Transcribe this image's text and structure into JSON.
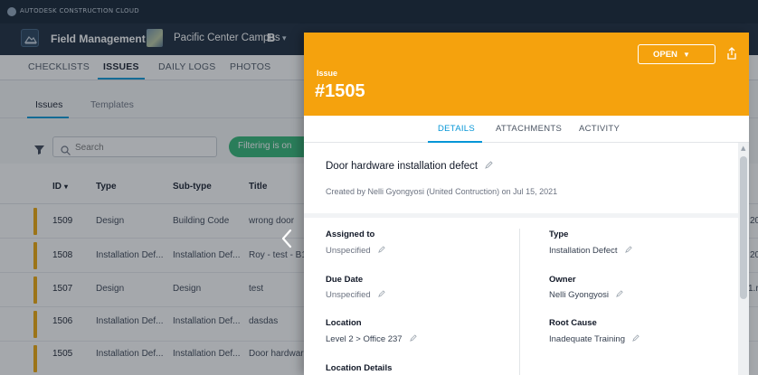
{
  "brand": {
    "text": "AUTODESK CONSTRUCTION CLOUD"
  },
  "project_bar": {
    "tool": "Field Management",
    "project": "Pacific Center Campus",
    "badge": "B"
  },
  "tabs": [
    "CHECKLISTS",
    "ISSUES",
    "DAILY LOGS",
    "PHOTOS"
  ],
  "active_tab": "ISSUES",
  "subtabs": [
    "Issues",
    "Templates"
  ],
  "toolbar": {
    "search_placeholder": "Search",
    "filter_pill": "Filtering is on"
  },
  "table": {
    "columns": [
      "ID",
      "Type",
      "Sub-type",
      "Title"
    ],
    "rows": [
      {
        "id": "1509",
        "type": "Design",
        "subtype": "Building Code",
        "title": "wrong door",
        "right": "20"
      },
      {
        "id": "1508",
        "type": "Installation Def...",
        "subtype": "Installation Def...",
        "title": "Roy - test - B1",
        "right": "20"
      },
      {
        "id": "1507",
        "type": "Design",
        "subtype": "Design",
        "title": "test",
        "right": "1.r"
      },
      {
        "id": "1506",
        "type": "Installation Def...",
        "subtype": "Installation Def...",
        "title": "dasdas",
        "right": ""
      },
      {
        "id": "1505",
        "type": "Installation Def...",
        "subtype": "Installation Def...",
        "title": "Door hardwar",
        "right": ""
      }
    ]
  },
  "panel": {
    "kicker": "Issue",
    "number": "#1505",
    "status": "OPEN",
    "tabs": [
      "DETAILS",
      "ATTACHMENTS",
      "ACTIVITY"
    ],
    "title": "Door hardware installation defect",
    "created": "Created by Nelli Gyongyosi (United Contruction) on Jul 15, 2021",
    "fields": {
      "assigned_label": "Assigned to",
      "assigned_value": "Unspecified",
      "type_label": "Type",
      "type_value": "Installation Defect",
      "due_label": "Due Date",
      "due_value": "Unspecified",
      "owner_label": "Owner",
      "owner_value": "Nelli Gyongyosi",
      "location_label": "Location",
      "location_value": "Level 2 > Office 237",
      "root_label": "Root Cause",
      "root_value": "Inadequate Training",
      "location_details_label": "Location Details"
    }
  },
  "colors": {
    "accent": "#0696d7",
    "issue_header": "#f5a20d",
    "filter_pill": "#2bb673",
    "row_marker": "#f0a500"
  }
}
